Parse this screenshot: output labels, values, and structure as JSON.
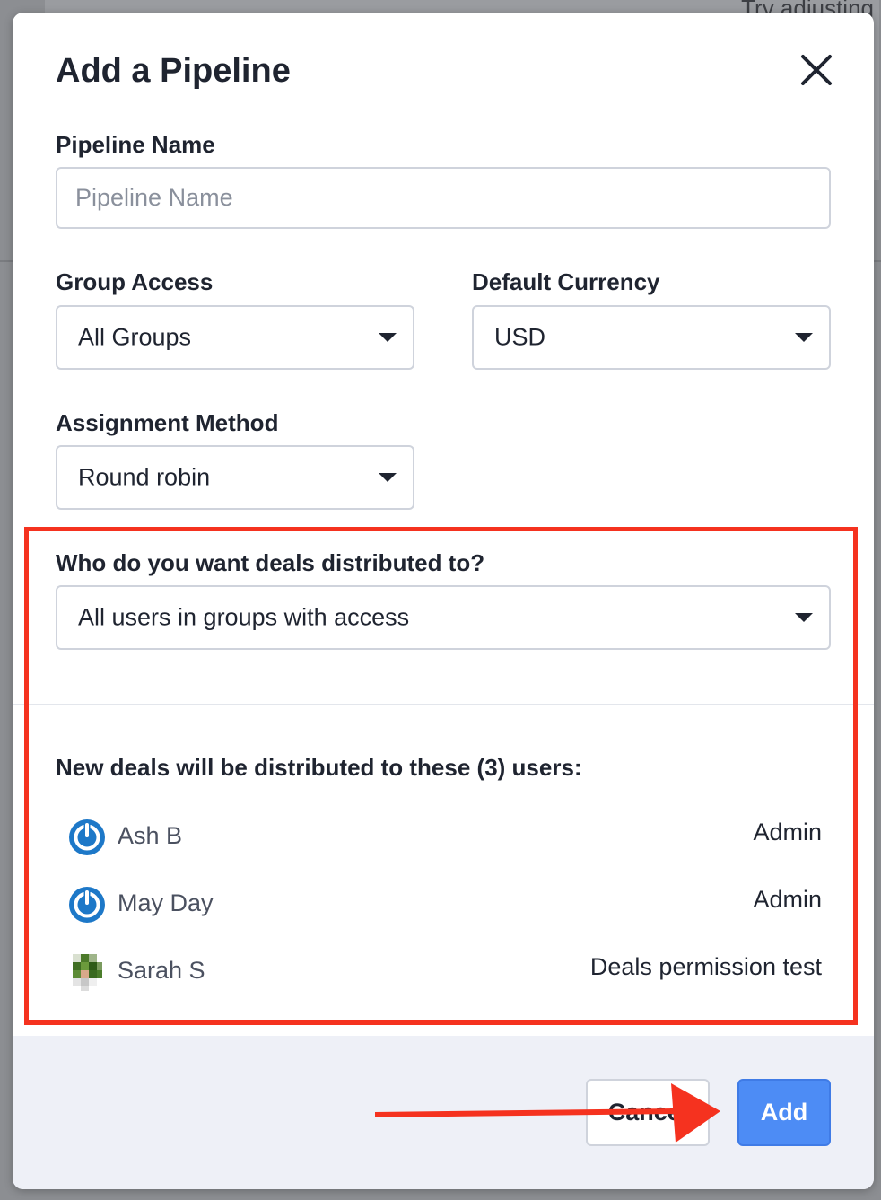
{
  "background": {
    "peek_text": "Try adjusting"
  },
  "modal": {
    "title": "Add a Pipeline",
    "pipeline_name": {
      "label": "Pipeline Name",
      "value": "",
      "placeholder": "Pipeline Name"
    },
    "group_access": {
      "label": "Group Access",
      "selected": "All Groups"
    },
    "default_currency": {
      "label": "Default Currency",
      "selected": "USD"
    },
    "assignment_method": {
      "label": "Assignment Method",
      "selected": "Round robin"
    },
    "distribution": {
      "label": "Who do you want deals distributed to?",
      "selected": "All users in groups with access"
    },
    "users_heading": "New deals will be distributed to these (3) users:",
    "users": [
      {
        "name": "Ash B",
        "role": "Admin",
        "avatar": "power-logo-icon"
      },
      {
        "name": "May Day",
        "role": "Admin",
        "avatar": "power-logo-icon"
      },
      {
        "name": "Sarah S",
        "role": "Deals permission test",
        "avatar": "pixel-avatar"
      }
    ],
    "footer": {
      "cancel_label": "Cancel",
      "add_label": "Add"
    }
  },
  "colors": {
    "accent": "#4d8cf5",
    "annotation": "#f5321f",
    "footer_bg": "#eef0f7"
  }
}
